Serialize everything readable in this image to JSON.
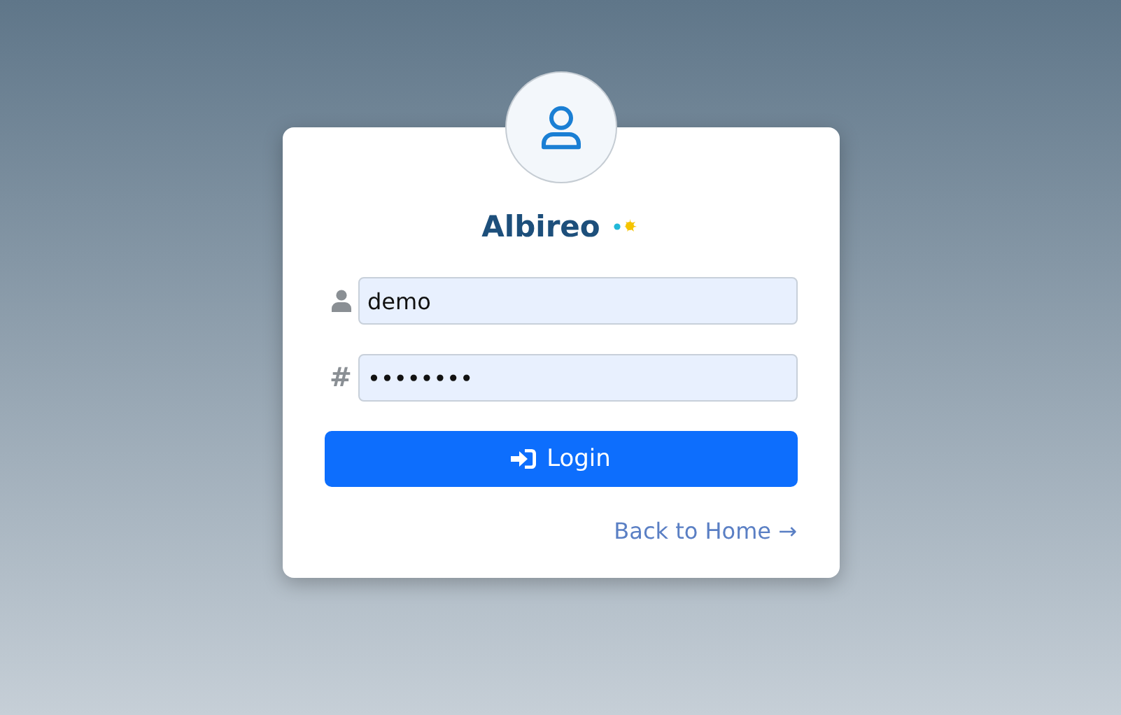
{
  "title": "Albireo",
  "fields": [
    {
      "kind": "user",
      "value": "demo"
    },
    {
      "kind": "hash",
      "symbol": "#",
      "value": "••••••••"
    }
  ],
  "login_button": "Login",
  "back_link": "Back to Home →"
}
